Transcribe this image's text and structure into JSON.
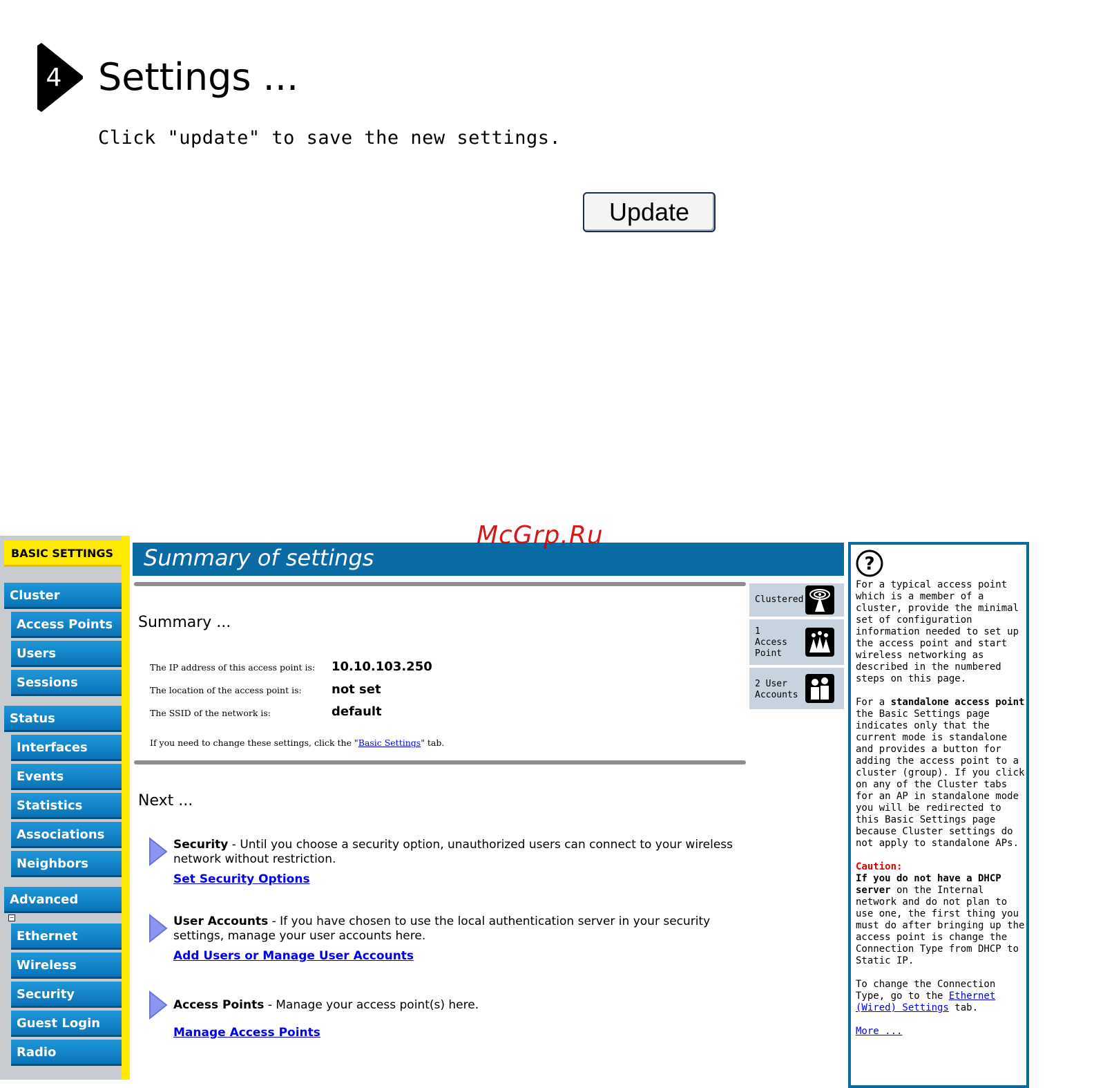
{
  "step": {
    "number": "4",
    "title": "Settings ...",
    "instruction": "Click \"update\" to save the new settings.",
    "update_label": "Update"
  },
  "watermark": "McGrp.Ru",
  "nav": {
    "header": "BASIC SETTINGS",
    "items": [
      {
        "label": "Cluster",
        "level": "top"
      },
      {
        "label": "Access Points",
        "level": "sub"
      },
      {
        "label": "Users",
        "level": "sub"
      },
      {
        "label": "Sessions",
        "level": "sub"
      },
      {
        "label": "Status",
        "level": "top"
      },
      {
        "label": "Interfaces",
        "level": "sub"
      },
      {
        "label": "Events",
        "level": "sub"
      },
      {
        "label": "Statistics",
        "level": "sub"
      },
      {
        "label": "Associations",
        "level": "sub"
      },
      {
        "label": "Neighbors",
        "level": "sub"
      },
      {
        "label": "Advanced",
        "level": "top"
      },
      {
        "label": "Ethernet",
        "level": "sub"
      },
      {
        "label": "Wireless",
        "level": "sub"
      },
      {
        "label": "Security",
        "level": "sub"
      },
      {
        "label": "Guest Login",
        "level": "sub"
      },
      {
        "label": "Radio",
        "level": "sub"
      }
    ]
  },
  "main": {
    "banner_title": "Summary of settings",
    "summary_title": "Summary ...",
    "ip_label": "The IP address of this access point is:",
    "ip_value": "10.10.103.250",
    "location_label": "The location of the access point is:",
    "location_value": "not set",
    "ssid_label": "The SSID of the network is:",
    "ssid_value": "default",
    "change_prefix": "If you need to change these settings, click the \"",
    "change_link": "Basic Settings",
    "change_suffix": "\" tab.",
    "next_title": "Next ...",
    "next_items": [
      {
        "title": "Security",
        "text": " - Until you choose a security option, unauthorized users can connect to your wireless network without restriction.",
        "link": "Set Security Options"
      },
      {
        "title": "User Accounts",
        "text": " - If you have chosen to use the local authentication server in your security settings, manage your user accounts here.",
        "link": "Add Users or Manage User Accounts"
      },
      {
        "title": "Access Points",
        "text": " - Manage your access point(s) here.",
        "link": "Manage Access Points"
      }
    ]
  },
  "badges": [
    {
      "line1": "Clustered",
      "line2": "",
      "line3": "",
      "icon": "cluster-icon"
    },
    {
      "line1": "1",
      "line2": "Access",
      "line3": "Point",
      "icon": "access-point-icon"
    },
    {
      "line1": "2 User",
      "line2": "Accounts",
      "line3": "",
      "icon": "users-icon"
    }
  ],
  "help": {
    "p1": "For a typical access point which is a member of a cluster, provide the minimal set of configuration information needed to set up the access point and start wireless networking as described in the numbered steps on this page.",
    "p2_prefix": "For a ",
    "p2_bold": "standalone access point",
    "p2_rest": " the Basic Settings page indicates only that the current mode is standalone and provides a button for adding the access point to a cluster (group). If you click on any of the Cluster tabs for an AP in standalone mode you will be redirected to this Basic Settings page because Cluster settings do not apply to standalone APs.",
    "caution_label": "Caution:",
    "caution_bold": "If you do not have a DHCP server",
    "caution_rest": " on the Internal network and do not plan to use one, the first thing you must do after bringing up the access point is change the Connection Type from DHCP to Static IP.",
    "p4_prefix": "To change the Connection Type, go to the ",
    "p4_link": "Ethernet (Wired) Settings",
    "p4_suffix": " tab.",
    "more_link": "More ..."
  }
}
